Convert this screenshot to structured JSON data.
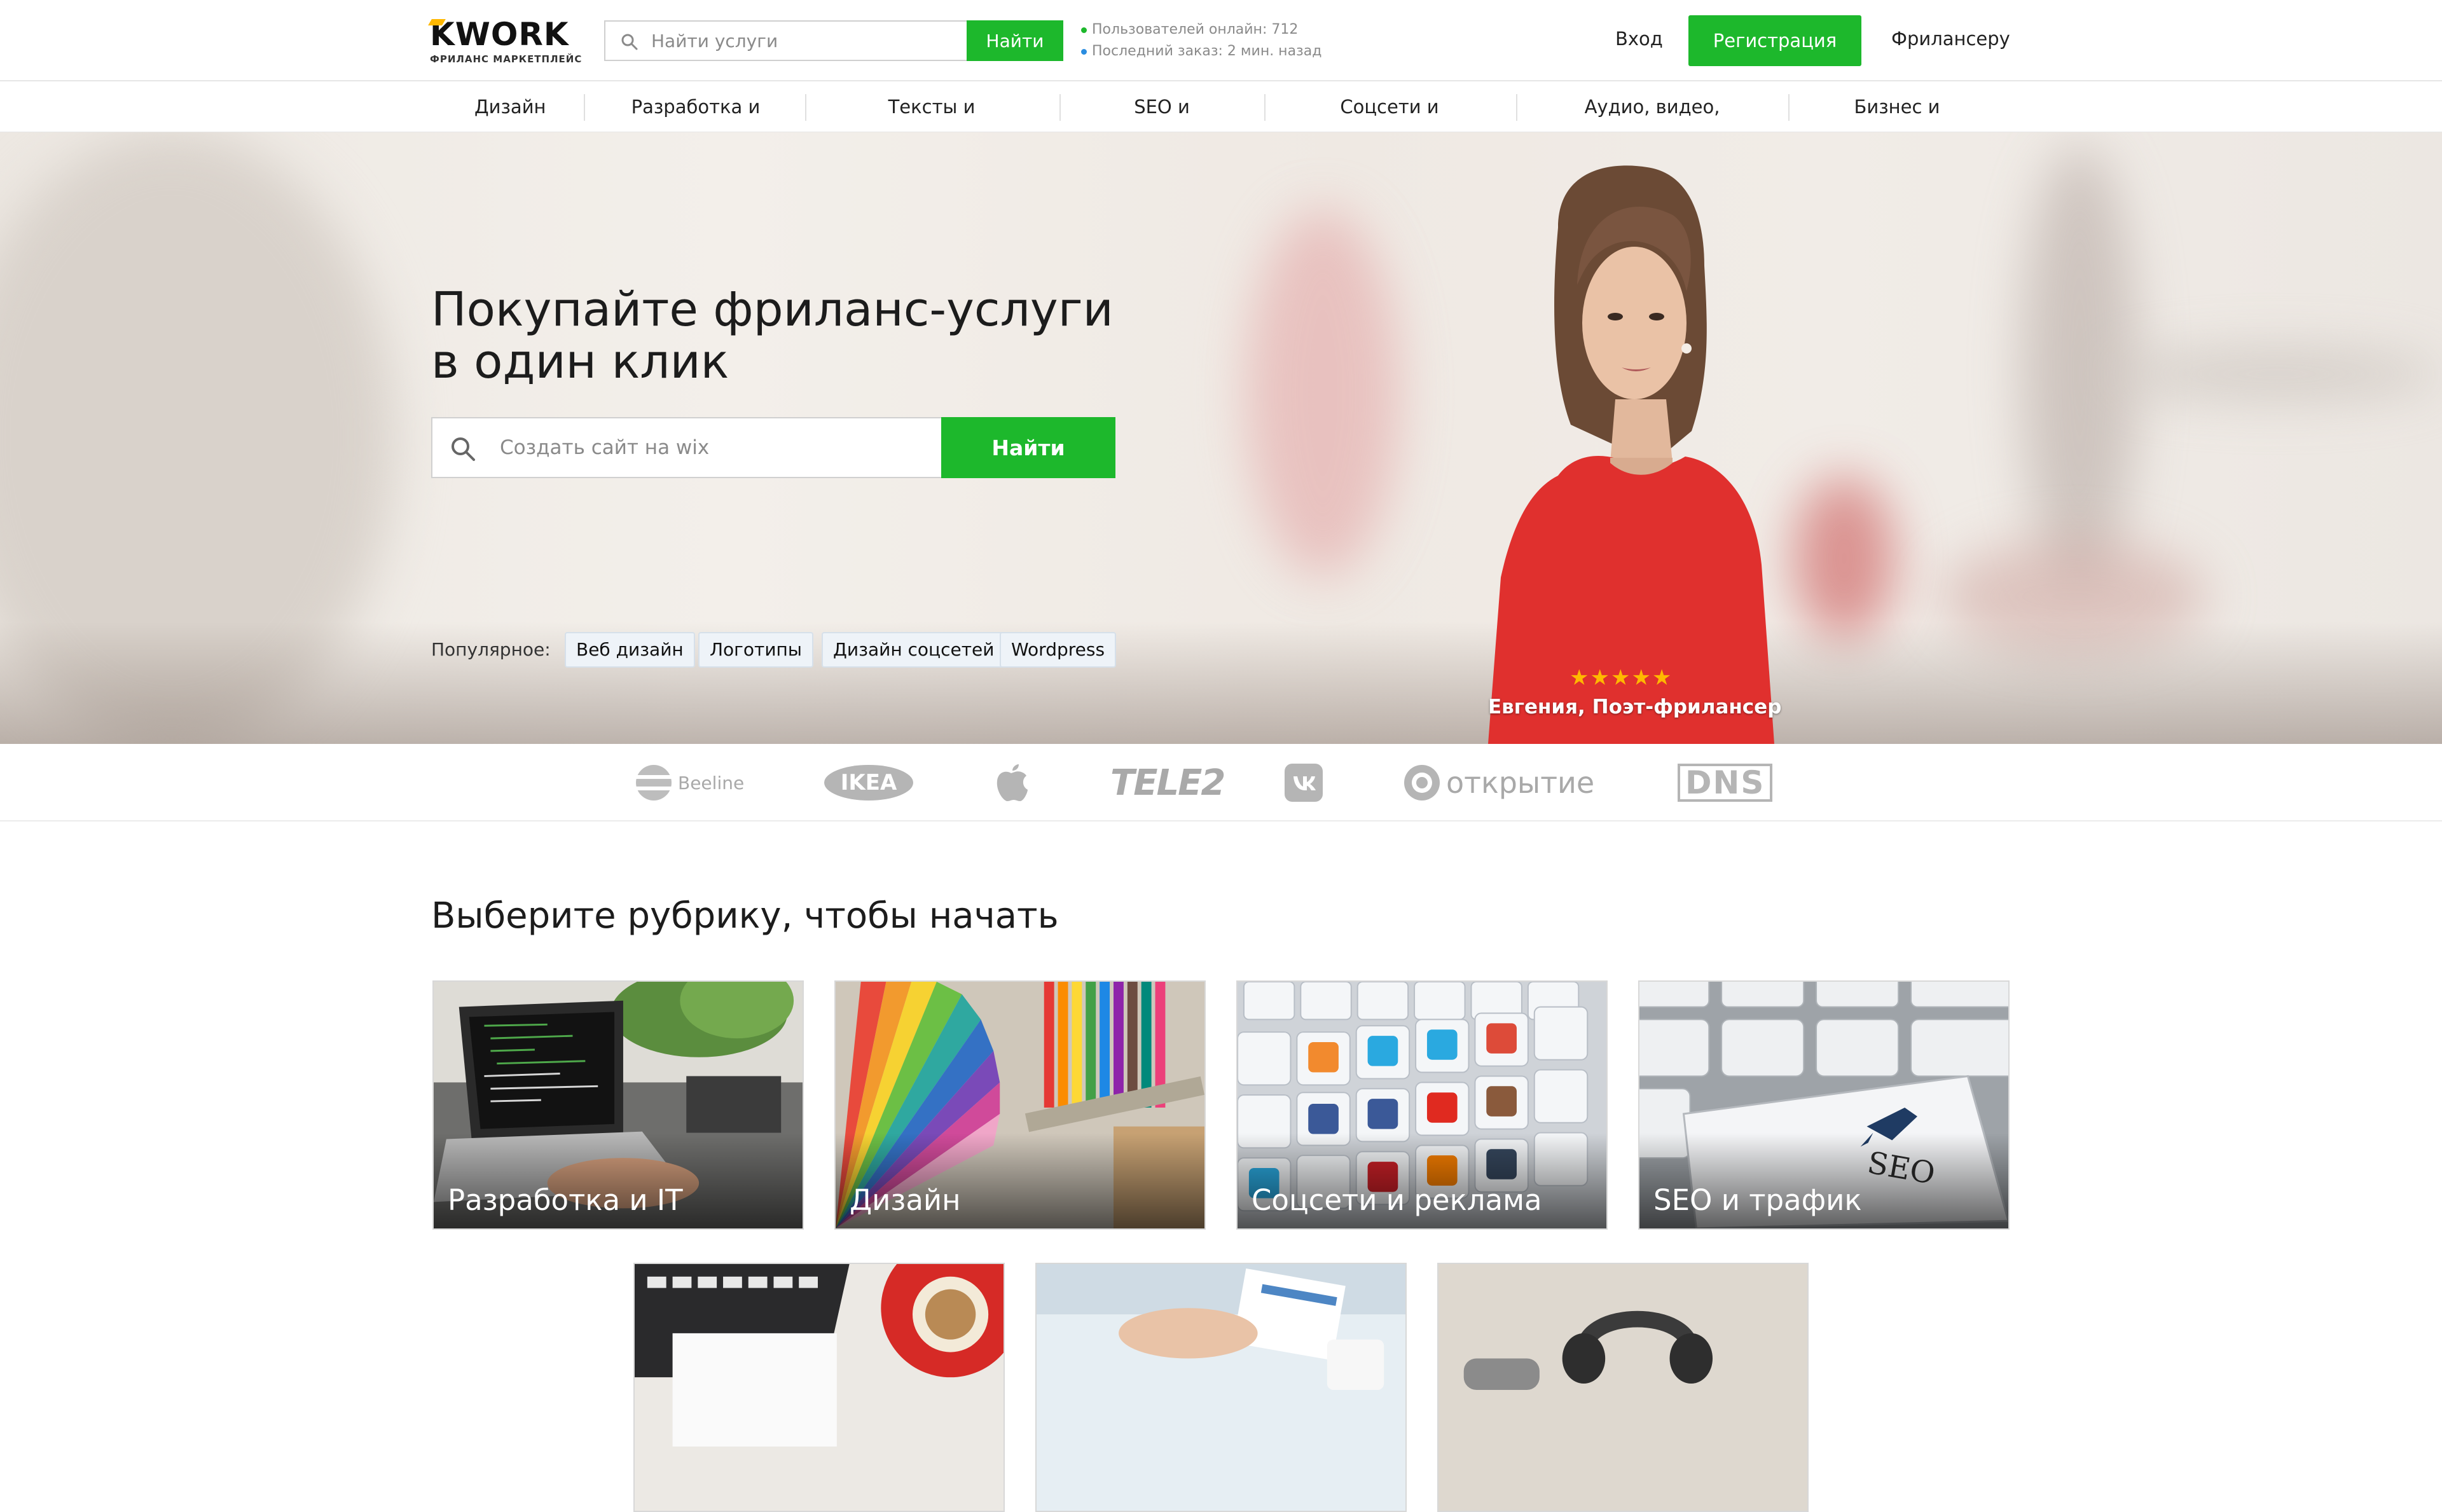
{
  "header": {
    "logo_text": "KWORK",
    "logo_subtitle": "ФРИЛАНС МАРКЕТПЛЕЙС",
    "search_placeholder": "Найти услуги",
    "search_button": "Найти",
    "online_users": "Пользователей онлайн: 712",
    "last_order": "Последний заказ: 2 мин. назад",
    "login": "Вход",
    "register": "Регистрация",
    "freelancer": "Фрилансеру",
    "accent_color": "#1db82c"
  },
  "nav": {
    "items": [
      "Дизайн",
      "Разработка и IT",
      "Тексты и переводы",
      "SEO и трафик",
      "Соцсети и реклама",
      "Аудио, видео, съемка",
      "Бизнес и жизнь"
    ]
  },
  "hero": {
    "title_line1": "Покупайте фриланс-услуги",
    "title_line2": "в один клик",
    "search_placeholder": "Создать сайт на wix",
    "search_button": "Найти",
    "popular_label": "Популярное:",
    "tags": [
      "Веб дизайн",
      "Логотипы",
      "Дизайн соцсетей",
      "Wordpress"
    ],
    "rating_stars": "★★★★★",
    "rating_value": 5,
    "caption": "Евгения,  Поэт-фрилансер"
  },
  "brands": [
    "Beeline",
    "IKEA",
    "apple-logo-icon",
    "TELE2",
    "vk-logo-icon",
    "открытие",
    "DNS"
  ],
  "rubrics": {
    "title": "Выберите рубрику, чтобы начать",
    "cards": [
      "Разработка и IT",
      "Дизайн",
      "Соцсети и реклама",
      "SEO и трафик"
    ]
  }
}
